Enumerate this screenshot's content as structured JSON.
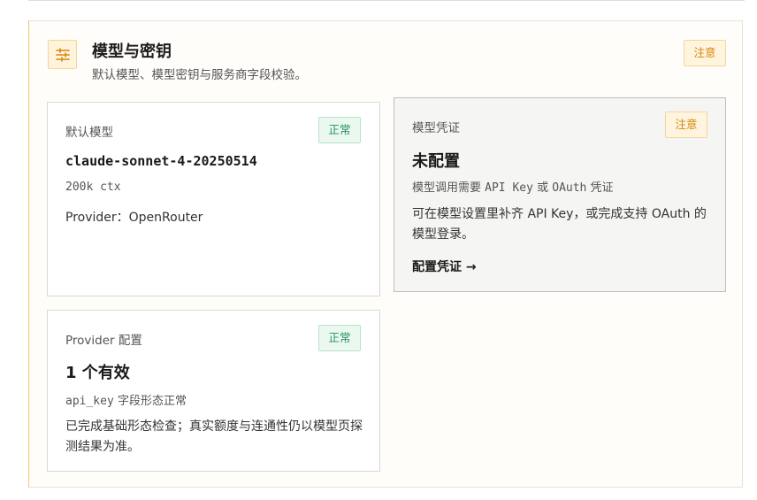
{
  "section": {
    "title": "模型与密钥",
    "subtitle": "默认模型、模型密钥与服务商字段校验。",
    "badge": "注意",
    "icon": "sliders-icon",
    "accent": "#f0c870"
  },
  "cards": {
    "default_model": {
      "label": "默认模型",
      "badge": "正常",
      "model_id": "claude-sonnet-4-20250514",
      "context": "200k ctx",
      "provider": "Provider：OpenRouter"
    },
    "credentials": {
      "label": "模型凭证",
      "badge": "注意",
      "title": "未配置",
      "hint_prefix": "模型调用需要",
      "hint_key1": "API Key",
      "hint_or": "或",
      "hint_key2": "OAuth",
      "hint_suffix": "凭证",
      "description": "可在模型设置里补齐 API Key，或完成支持 OAuth 的模型登录。",
      "action": "配置凭证 →"
    },
    "provider_config": {
      "label": "Provider 配置",
      "badge": "正常",
      "title": "1 个有效",
      "field_name": "api_key",
      "field_status": "字段形态正常",
      "description": "已完成基础形态检查；真实额度与连通性仍以模型页探测结果为准。"
    }
  },
  "colors": {
    "warn_text": "#d3880d",
    "warn_bg": "#fff4de",
    "ok_text": "#24935a",
    "ok_bg": "#eaf8f0"
  }
}
